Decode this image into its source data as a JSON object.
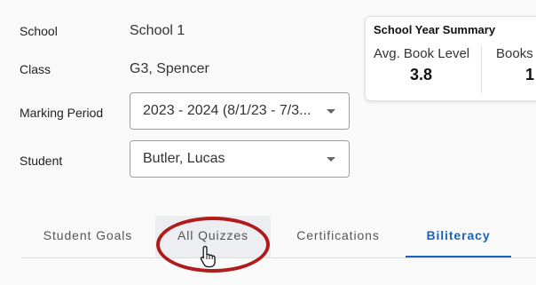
{
  "fields": {
    "school": {
      "label": "School",
      "value": "School 1"
    },
    "class": {
      "label": "Class",
      "value": "G3, Spencer"
    },
    "marking_period": {
      "label": "Marking Period",
      "selected": "2023 - 2024 (8/1/23 - 7/3..."
    },
    "student": {
      "label": "Student",
      "selected": "Butler, Lucas"
    }
  },
  "summary": {
    "title": "School Year Summary",
    "metrics": [
      {
        "label": "Avg. Book Level",
        "value": "3.8"
      },
      {
        "label": "Books",
        "value": "1"
      }
    ]
  },
  "tabs": [
    {
      "label": "Student Goals",
      "active": false
    },
    {
      "label": "All Quizzes",
      "active": false,
      "hovered": true
    },
    {
      "label": "Certifications",
      "active": false
    },
    {
      "label": "Biliteracy",
      "active": true
    }
  ],
  "colors": {
    "accent": "#1565c0",
    "annotation_ring": "#b01c1c",
    "background": "#fafafa"
  },
  "icons": {
    "cursor": "hand-pointer-icon",
    "dropdown": "caret-down-icon"
  }
}
